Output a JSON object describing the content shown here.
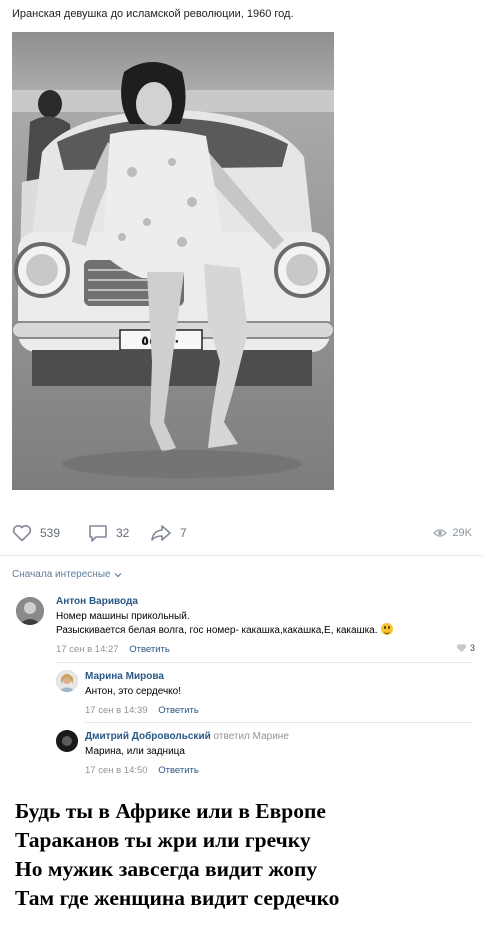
{
  "post": {
    "caption": "Иранская девушка до исламской революции, 1960 год."
  },
  "actions": {
    "likes": "539",
    "comments": "32",
    "shares": "7",
    "views": "29K"
  },
  "comments_sort": "Сначала интересные",
  "comments": [
    {
      "author": "Антон Варивода",
      "text_line1": "Номер машины прикольный.",
      "text_line2": "Разыскивается белая волга, гос номер- какашка,какашка,Е, какашка.",
      "date": "17 сен в 14:27",
      "reply_label": "Ответить",
      "likes": "3"
    },
    {
      "author": "Марина Мирова",
      "text": "Антон, это сердечко!",
      "date": "17 сен в 14:39",
      "reply_label": "Ответить"
    },
    {
      "author": "Дмитрий Добровольский",
      "replied_to": "ответил Марине",
      "text": "Марина, или задница",
      "date": "17 сен в 14:50",
      "reply_label": "Ответить"
    }
  ],
  "poem": [
    "Будь ты в Африке или в Европе",
    "Тараканов ты жри или гречку",
    "Но мужик завсегда видит жопу",
    "Там где женщина видит сердечко"
  ],
  "license_plate": "٥٥٥٤٠"
}
